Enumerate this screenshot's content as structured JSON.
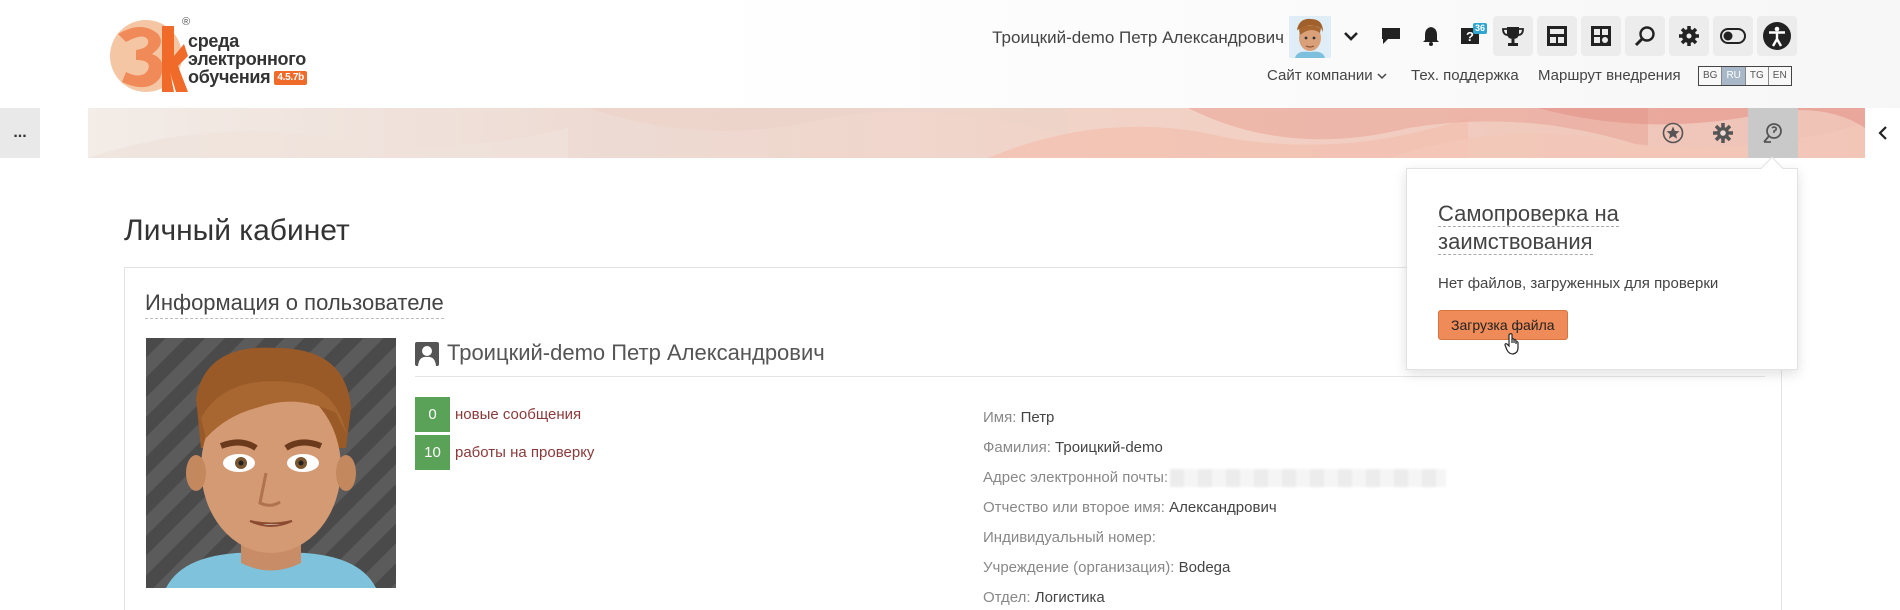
{
  "header": {
    "logo_line1": "среда",
    "logo_line2": "электронного",
    "logo_line3": "обучения",
    "logo_version": "4.5.7b",
    "logo_reg": "®",
    "user_name": "Троицкий-demo Петр Александрович",
    "help_badge": "36",
    "links": {
      "company_site": "Сайт компании",
      "support": "Тех. поддержка",
      "route": "Маршрут внедрения"
    },
    "languages": [
      "BG",
      "RU",
      "TG",
      "EN"
    ],
    "active_language": "RU"
  },
  "banner": {
    "left_button": "...",
    "colors": {
      "active_button": "#c9c9c9"
    }
  },
  "main": {
    "page_title": "Личный кабинет",
    "panel_title": "Информация о пользователе",
    "profile_name": "Троицкий-demo Петр Александрович",
    "stats": [
      {
        "count": "0",
        "label": "новые сообщения"
      },
      {
        "count": "10",
        "label": "работы на проверку"
      }
    ],
    "info": [
      {
        "label": "Имя:",
        "value": "Петр"
      },
      {
        "label": "Фамилия:",
        "value": "Троицкий-demo"
      },
      {
        "label": "Адрес электронной почты:",
        "value": ""
      },
      {
        "label": "Отчество или второе имя:",
        "value": "Александрович"
      },
      {
        "label": "Индивидуальный номер:",
        "value": ""
      },
      {
        "label": "Учреждение (организация):",
        "value": "Bodega"
      },
      {
        "label": "Отдел:",
        "value": "Логистика"
      }
    ]
  },
  "popover": {
    "title": "Самопроверка на заимствования",
    "text": "Нет файлов, загруженных для проверки",
    "button": "Загрузка файла"
  },
  "colors": {
    "accent_orange": "#ee8b58",
    "stat_green": "#5aa257",
    "link_red": "#8b3a3a",
    "logo_orange": "#f06a2a"
  }
}
